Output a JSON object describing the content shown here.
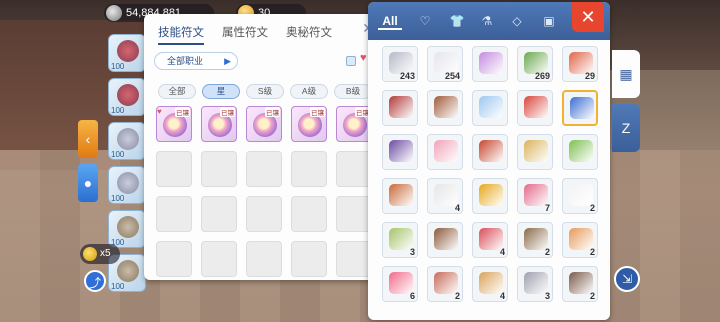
{
  "top_bar": {
    "zeny_label": "54,884,881",
    "gem_label": "30"
  },
  "left_cards": [
    "100",
    "100",
    "100",
    "100",
    "100",
    "100"
  ],
  "coin_counter": "x5",
  "rune_panel": {
    "tabs": [
      "技能符文",
      "属性符文",
      "奥秘符文"
    ],
    "active_tab": 0,
    "job_select": "全部职业",
    "grades": [
      "全部",
      "星",
      "S级",
      "A级",
      "B级"
    ],
    "active_grade": 1,
    "equipped_tag": "已镶",
    "slots_filled": 5,
    "slots_total": 25
  },
  "inventory": {
    "tabs": [
      "All",
      "heart-icon",
      "shirt-icon",
      "potion-icon",
      "diamond-icon",
      "card-icon"
    ],
    "items": [
      {
        "qty": "243",
        "icon": "feather-icon",
        "color": "#b8b8c8"
      },
      {
        "qty": "254",
        "icon": "white-feather-icon",
        "color": "#e4e4ec"
      },
      {
        "qty": "",
        "icon": "butterfly-wings-icon",
        "color": "#c58be0"
      },
      {
        "qty": "269",
        "icon": "herb-icon",
        "color": "#6aa84f"
      },
      {
        "qty": "29",
        "icon": "card-pack-icon",
        "color": "#e0644a"
      },
      {
        "qty": "",
        "icon": "red-book-icon",
        "color": "#b23a3a"
      },
      {
        "qty": "",
        "icon": "gift-bag-icon",
        "color": "#a05a3a"
      },
      {
        "qty": "",
        "icon": "crystal-icon",
        "color": "#9cc8ef"
      },
      {
        "qty": "",
        "icon": "gift-box-icon",
        "color": "#d9453a"
      },
      {
        "qty": "",
        "icon": "blue-scroll-icon",
        "color": "#3d6fd1"
      },
      {
        "qty": "",
        "icon": "purple-hat-icon",
        "color": "#6c4aa3"
      },
      {
        "qty": "",
        "icon": "pink-box-icon",
        "color": "#f1a3b8"
      },
      {
        "qty": "",
        "icon": "spell-book-icon",
        "color": "#c8452e"
      },
      {
        "qty": "",
        "icon": "treasure-icon",
        "color": "#d9b45a"
      },
      {
        "qty": "",
        "icon": "green-box-icon",
        "color": "#7dbf4f"
      },
      {
        "qty": "",
        "icon": "backpack-icon",
        "color": "#c86a3a"
      },
      {
        "qty": "4",
        "icon": "necklace-icon",
        "color": "#e6e6e6"
      },
      {
        "qty": "",
        "icon": "gold-coin-icon",
        "color": "#e6a81a"
      },
      {
        "qty": "7",
        "icon": "envelope-icon",
        "color": "#e26a8a"
      },
      {
        "qty": "2",
        "icon": "paper-icon",
        "color": "#f3f3f3"
      },
      {
        "qty": "3",
        "icon": "rice-cake-icon",
        "color": "#a5c36a"
      },
      {
        "qty": "",
        "icon": "chocolate-icon",
        "color": "#8a5a3a"
      },
      {
        "qty": "4",
        "icon": "flower-icon",
        "color": "#d94d5a"
      },
      {
        "qty": "2",
        "icon": "basket-icon",
        "color": "#8a6a4a"
      },
      {
        "qty": "2",
        "icon": "dish-icon",
        "color": "#e69a5a"
      },
      {
        "qty": "6",
        "icon": "pink-potion-icon",
        "color": "#f16a8a"
      },
      {
        "qty": "2",
        "icon": "cake-icon",
        "color": "#c86a5a"
      },
      {
        "qty": "4",
        "icon": "pastry-icon",
        "color": "#d9a35a"
      },
      {
        "qty": "3",
        "icon": "figure-icon",
        "color": "#a0a0b0"
      },
      {
        "qty": "2",
        "icon": "cooking-pot-icon",
        "color": "#7a5a4a"
      }
    ],
    "selected_index": 9,
    "close_label": "✕"
  }
}
